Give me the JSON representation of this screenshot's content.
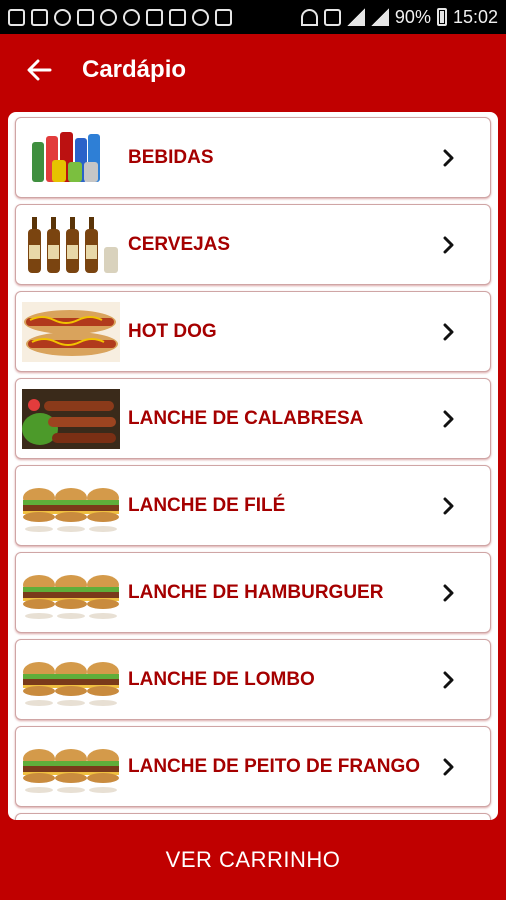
{
  "status": {
    "battery": "90%",
    "time": "15:02"
  },
  "header": {
    "title": "Cardápio"
  },
  "menu": {
    "items": [
      {
        "label": "BEBIDAS",
        "image": "beverages-photo"
      },
      {
        "label": "CERVEJAS",
        "image": "beer-bottles-photo"
      },
      {
        "label": "HOT DOG",
        "image": "hot-dog-photo"
      },
      {
        "label": "LANCHE DE CALABRESA",
        "image": "sausage-skewers-photo"
      },
      {
        "label": "LANCHE DE FILÉ",
        "image": "sandwiches-photo"
      },
      {
        "label": "LANCHE DE HAMBURGUER",
        "image": "sandwiches-photo"
      },
      {
        "label": "LANCHE DE LOMBO",
        "image": "sandwiches-photo"
      },
      {
        "label": "LANCHE DE PEITO DE FRANGO",
        "image": "sandwiches-photo"
      }
    ]
  },
  "footer": {
    "cart_label": "VER CARRINHO"
  },
  "colors": {
    "primary": "#c00000",
    "item_text": "#a50000",
    "surface": "#ffffff"
  }
}
